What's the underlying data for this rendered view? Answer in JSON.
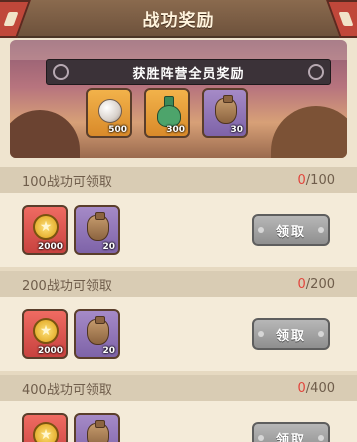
{
  "title": "战功奖励",
  "banner": {
    "ribbon_text": "获胜阵营全员奖励",
    "items": [
      {
        "icon": "pearl-icon",
        "qty": "500",
        "color": "orange"
      },
      {
        "icon": "flask-icon",
        "qty": "300",
        "color": "orange"
      },
      {
        "icon": "sack-icon",
        "qty": "30",
        "color": "purple"
      }
    ]
  },
  "sections": [
    {
      "label": "100战功可领取",
      "current": "0",
      "total": "/100",
      "claim_label": "领取",
      "items": [
        {
          "icon": "coin-icon",
          "qty": "2000",
          "color": "red"
        },
        {
          "icon": "sack-icon",
          "qty": "20",
          "color": "purple"
        }
      ]
    },
    {
      "label": "200战功可领取",
      "current": "0",
      "total": "/200",
      "claim_label": "领取",
      "items": [
        {
          "icon": "coin-icon",
          "qty": "2000",
          "color": "red"
        },
        {
          "icon": "sack-icon",
          "qty": "20",
          "color": "purple"
        }
      ]
    },
    {
      "label": "400战功可领取",
      "current": "0",
      "total": "/400",
      "claim_label": "领取",
      "items": [
        {
          "icon": "coin-icon",
          "qty": "",
          "color": "red"
        },
        {
          "icon": "sack-icon",
          "qty": "",
          "color": "purple"
        }
      ]
    }
  ]
}
